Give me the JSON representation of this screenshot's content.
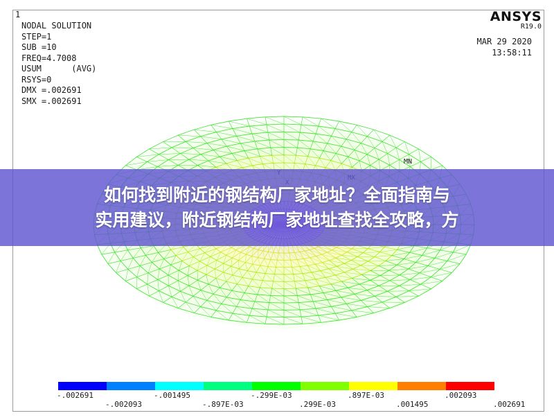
{
  "window_number": "1",
  "solution_info": {
    "title": "NODAL SOLUTION",
    "lines": [
      "STEP=1",
      "SUB =10",
      "FREQ=4.7008",
      "USUM      (AVG)",
      "RSYS=0",
      "DMX =.002691",
      "SMX =.002691"
    ]
  },
  "brand": {
    "name": "ANSYS",
    "version": "R19.0"
  },
  "timestamp": {
    "date": "MAR 29 2020",
    "time": "13:58:11"
  },
  "model_labels": {
    "mn": "MN",
    "mx": "MX",
    "y_axis": "Y",
    "x_axis": "X"
  },
  "banner": {
    "line1": "如何找到附近的钢结构厂家地址？全面指南与",
    "line2": "实用建议，附近钢结构厂家地址查找全攻略，方"
  },
  "legend": {
    "colors": [
      "#0000ff",
      "#0080ff",
      "#00ffff",
      "#00ff80",
      "#00ff00",
      "#80ff00",
      "#ffff00",
      "#ff8000",
      "#ff0000"
    ],
    "top_labels": [
      "-.002691",
      "-.001495",
      "-.299E-03",
      ".897E-03",
      ".002093"
    ],
    "bottom_labels": [
      "-.002093",
      "-.897E-03",
      ".299E-03",
      ".001495",
      ".002691"
    ]
  }
}
